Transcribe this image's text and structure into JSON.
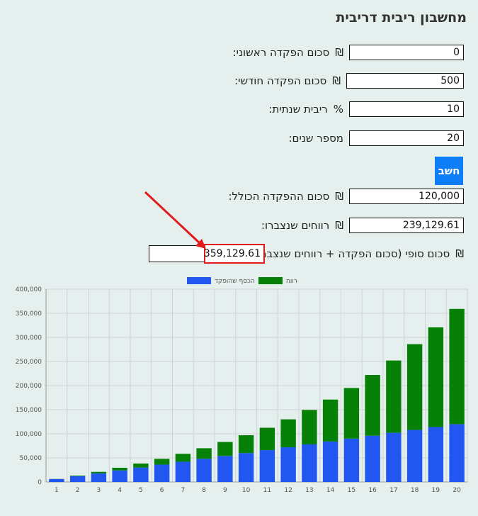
{
  "app": {
    "title": "מחשבון ריבית דריבית"
  },
  "form": {
    "initial_deposit": {
      "label": "סכום הפקדה ראשוני:",
      "unit": "₪",
      "value": "0"
    },
    "monthly_deposit": {
      "label": "סכום הפקדה חודשי:",
      "unit": "₪",
      "value": "500"
    },
    "annual_interest": {
      "label": "ריבית שנתית:",
      "unit": "%",
      "value": "10"
    },
    "years": {
      "label": "מספר שנים:",
      "value": "20"
    }
  },
  "calc_button": {
    "label": "חשב"
  },
  "results": {
    "total_deposit": {
      "label": "סכום ההפקדה הכולל:",
      "unit": "₪",
      "value": "120,000"
    },
    "earnings": {
      "label": "רווחים שנצברו:",
      "unit": "₪",
      "value": "239,129.61"
    },
    "final_amount": {
      "label": "סכום סופי (סכום הפקדה + רווחים שנצברו):",
      "unit": "₪",
      "value": "359,129.61"
    }
  },
  "colors": {
    "deposited": "#2156f0",
    "profit": "#078007",
    "highlight": "#e01b1b",
    "button": "#0d7ef8"
  },
  "chart_data": {
    "type": "bar",
    "stacked": true,
    "categories": [
      "1",
      "2",
      "3",
      "4",
      "5",
      "6",
      "7",
      "8",
      "9",
      "10",
      "11",
      "12",
      "13",
      "14",
      "15",
      "16",
      "17",
      "18",
      "19",
      "20"
    ],
    "series": [
      {
        "name": "הכסף שהופקד",
        "color": "#2156f0",
        "values": [
          6000,
          12000,
          18000,
          24000,
          30000,
          36000,
          42000,
          48000,
          54000,
          60000,
          66000,
          72000,
          78000,
          84000,
          90000,
          96000,
          102000,
          108000,
          114000,
          120000
        ]
      },
      {
        "name": "רווח",
        "color": "#078007",
        "values": [
          300,
          1300,
          3000,
          5500,
          8300,
          12000,
          16500,
          22000,
          29000,
          37000,
          46500,
          58000,
          71500,
          87000,
          105000,
          126000,
          150000,
          178000,
          207000,
          239130
        ]
      }
    ],
    "ylim": [
      0,
      400000
    ],
    "yticks": [
      "0",
      "50,000",
      "100,000",
      "150,000",
      "200,000",
      "250,000",
      "300,000",
      "350,000",
      "400,000"
    ],
    "legend_position": "top",
    "grid": true
  }
}
